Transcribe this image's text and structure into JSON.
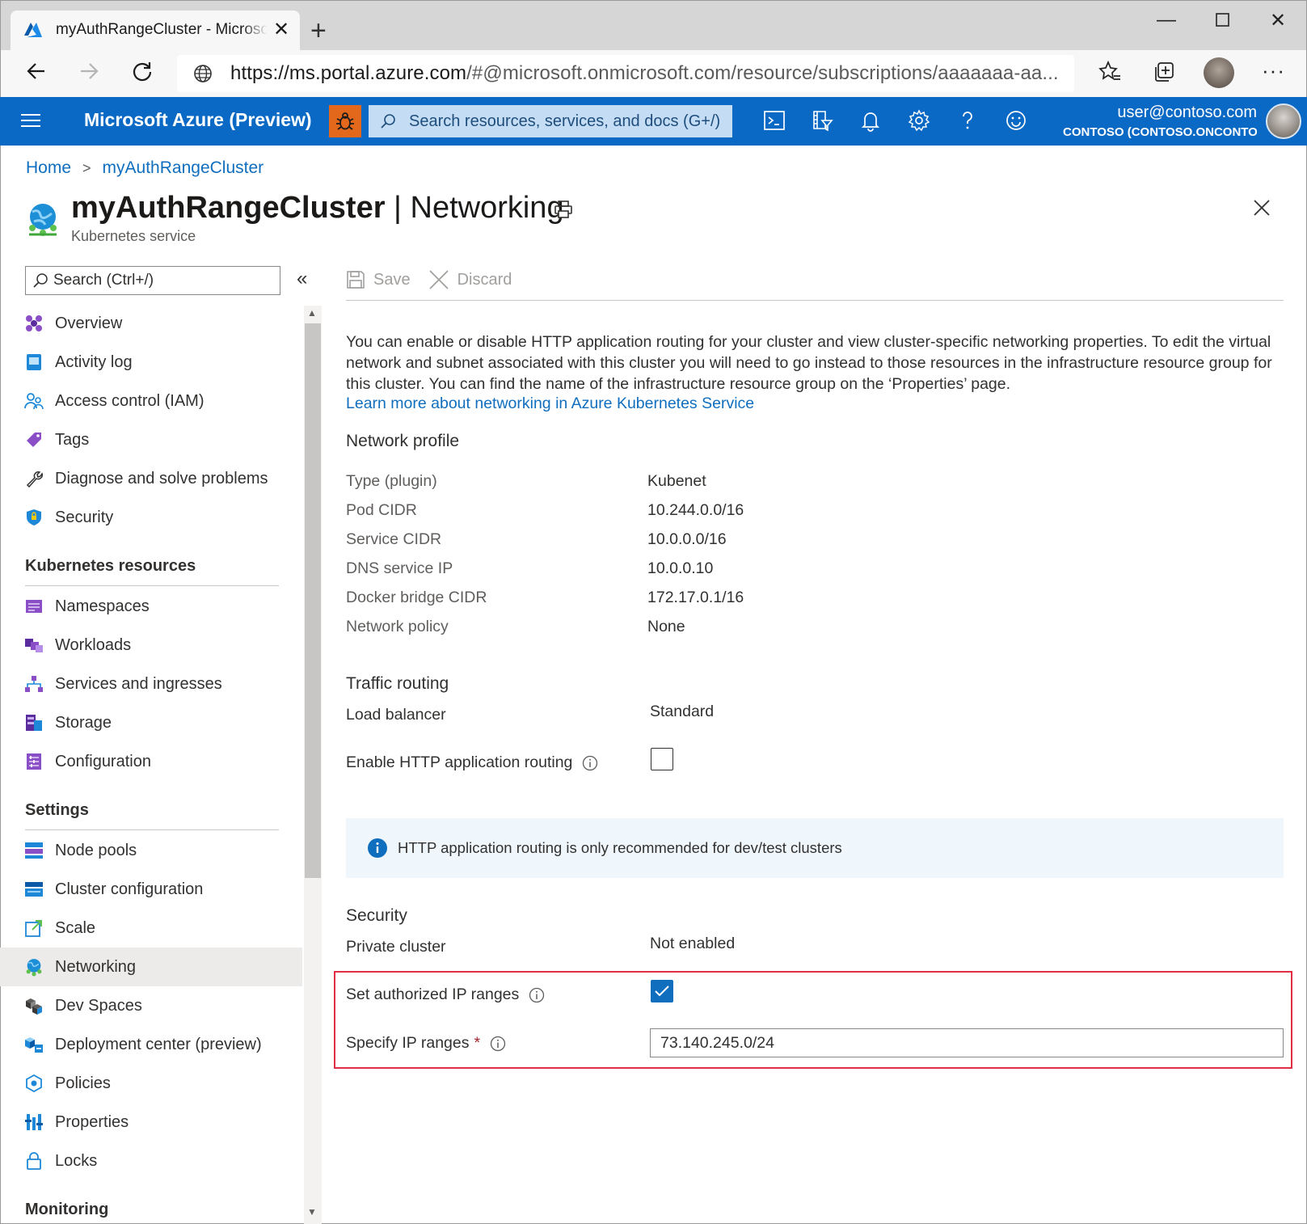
{
  "browser": {
    "tab_title": "myAuthRangeCluster - Microsoft Azure",
    "url_host": "https://ms.portal.azure.com",
    "url_rest": "/#@microsoft.onmicrosoft.com/resource/subscriptions/aaaaaaa-aa..."
  },
  "portal": {
    "title": "Microsoft Azure (Preview)",
    "search_placeholder": "Search resources, services, and docs (G+/)",
    "user_email": "user@contoso.com",
    "user_tenant": "CONTOSO (CONTOSO.ONCONTOSO.COM)",
    "brand_color": "#106ebe",
    "preview_badge_color": "#e3681c"
  },
  "breadcrumb": [
    "Home",
    "myAuthRangeCluster"
  ],
  "page": {
    "resource_name": "myAuthRangeCluster",
    "separator": " | ",
    "blade_name": "Networking",
    "subtitle": "Kubernetes service"
  },
  "nav": {
    "search_placeholder": "Search (Ctrl+/)",
    "items_top": [
      {
        "label": "Overview",
        "icon": "overview-icon"
      },
      {
        "label": "Activity log",
        "icon": "activity-log-icon"
      },
      {
        "label": "Access control (IAM)",
        "icon": "iam-icon"
      },
      {
        "label": "Tags",
        "icon": "tag-icon"
      },
      {
        "label": "Diagnose and solve problems",
        "icon": "wrench-icon"
      },
      {
        "label": "Security",
        "icon": "shield-icon"
      }
    ],
    "section_kubernetes": "Kubernetes resources",
    "items_kubernetes": [
      {
        "label": "Namespaces",
        "icon": "namespaces-icon"
      },
      {
        "label": "Workloads",
        "icon": "workloads-icon"
      },
      {
        "label": "Services and ingresses",
        "icon": "services-icon"
      },
      {
        "label": "Storage",
        "icon": "storage-icon"
      },
      {
        "label": "Configuration",
        "icon": "configuration-icon"
      }
    ],
    "section_settings": "Settings",
    "items_settings": [
      {
        "label": "Node pools",
        "icon": "node-pools-icon"
      },
      {
        "label": "Cluster configuration",
        "icon": "cluster-config-icon"
      },
      {
        "label": "Scale",
        "icon": "scale-icon"
      },
      {
        "label": "Networking",
        "icon": "networking-icon",
        "selected": true
      },
      {
        "label": "Dev Spaces",
        "icon": "dev-spaces-icon"
      },
      {
        "label": "Deployment center (preview)",
        "icon": "deployment-center-icon"
      },
      {
        "label": "Policies",
        "icon": "policies-icon"
      },
      {
        "label": "Properties",
        "icon": "properties-icon"
      },
      {
        "label": "Locks",
        "icon": "lock-icon"
      }
    ],
    "section_monitoring": "Monitoring"
  },
  "commands": {
    "save": "Save",
    "discard": "Discard"
  },
  "content": {
    "intro": "You can enable or disable HTTP application routing for your cluster and view cluster-specific networking properties. To edit the virtual network and subnet associated with this cluster you will need to go instead to those resources in the infrastructure resource group for this cluster. You can find the name of the infrastructure resource group on the ‘Properties’ page.",
    "learn_more": "Learn more about networking in Azure Kubernetes Service",
    "network_profile": {
      "heading": "Network profile",
      "rows": [
        {
          "label": "Type (plugin)",
          "value": "Kubenet"
        },
        {
          "label": "Pod CIDR",
          "value": "10.244.0.0/16"
        },
        {
          "label": "Service CIDR",
          "value": "10.0.0.0/16"
        },
        {
          "label": "DNS service IP",
          "value": "10.0.0.10"
        },
        {
          "label": "Docker bridge CIDR",
          "value": "172.17.0.1/16"
        },
        {
          "label": "Network policy",
          "value": "None"
        }
      ]
    },
    "traffic_routing": {
      "heading": "Traffic routing",
      "load_balancer_label": "Load balancer",
      "load_balancer_value": "Standard",
      "http_routing_label": "Enable HTTP application routing",
      "http_routing_checked": false,
      "info_message": "HTTP application routing is only recommended for dev/test clusters"
    },
    "security": {
      "heading": "Security",
      "private_cluster_label": "Private cluster",
      "private_cluster_value": "Not enabled",
      "authorized_ip_label": "Set authorized IP ranges",
      "authorized_ip_checked": true,
      "specify_ip_label": "Specify IP ranges",
      "required_marker": "*",
      "ip_ranges_value": "73.140.245.0/24",
      "highlight_color": "#e02f44"
    }
  }
}
